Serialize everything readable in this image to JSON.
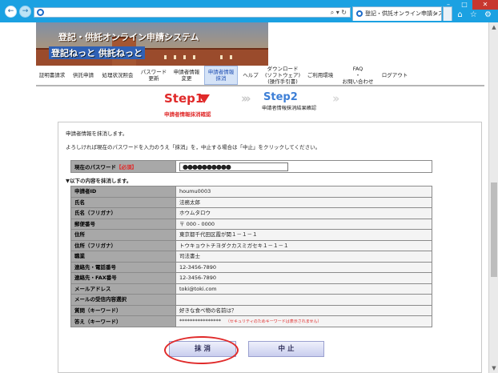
{
  "browser": {
    "tab_title": "登記・供託オンライン申請シス...",
    "address_controls": "⌕ ▾ ↻",
    "back_icon": "←",
    "forward_icon": "→",
    "window_buttons": [
      "–",
      "□",
      "✕"
    ],
    "toolbar_icons": "⌂ ☆ ⚙"
  },
  "banner": {
    "title": "登記・供託オンライン申請システム",
    "subtitle": "登記ねっと 供託ねっと"
  },
  "nav": [
    {
      "label": "証明書請求"
    },
    {
      "label": "供託申請"
    },
    {
      "label": "処理状況照会"
    },
    {
      "label": "パスワード\n更新"
    },
    {
      "label": "申請者情報\n変更"
    },
    {
      "label": "申請者情報\n抹消",
      "active": true
    },
    {
      "label": "ヘルプ"
    },
    {
      "label": "ダウンロード\n(ソフトウェア)\n(操作手引書)"
    },
    {
      "label": "ご利用環境"
    },
    {
      "label": "FAQ\n・\nお問い合わせ"
    },
    {
      "label": "ログアウト"
    }
  ],
  "steps": {
    "step1_label": "Step1",
    "step1_sub": "申請者情報抹消確認",
    "step2_label": "Step2",
    "step2_sub": "申請者情報抹消結果確認"
  },
  "messages": {
    "line1": "申請者情報を抹消します。",
    "line2": "よろしければ現在のパスワードを入力のうえ「抹消」を，中止する場合は「中止」をクリックしてください。",
    "note": "▼以下の内容を抹消します。"
  },
  "password": {
    "label": "現在のパスワード",
    "required": "【必須】",
    "value": "●●●●●●●●●●"
  },
  "details": [
    {
      "label": "申請者ID",
      "value": "houmu0003"
    },
    {
      "label": "氏名",
      "value": "法務太郎"
    },
    {
      "label": "氏名（フリガナ）",
      "value": "ホウムタロウ"
    },
    {
      "label": "郵便番号",
      "value": "〒 000 - 0000"
    },
    {
      "label": "住所",
      "value": "東京都千代田区霞が関１－１－１"
    },
    {
      "label": "住所（フリガナ）",
      "value": "トウキョウトチヨダクカスミガセキ１－１－１"
    },
    {
      "label": "職業",
      "value": "司法書士"
    },
    {
      "label": "連絡先・電話番号",
      "value": "12-3456-7890"
    },
    {
      "label": "連絡先・FAX番号",
      "value": "12-3456-7890"
    },
    {
      "label": "メールアドレス",
      "value": "toki@toki.com"
    },
    {
      "label": "メールの受信内容選択",
      "value": ""
    },
    {
      "label": "質問（キーワード）",
      "value": "好きな食べ物の名前は？"
    },
    {
      "label": "答え（キーワード）",
      "value": "****************",
      "note": "（セキュリティのためキーワードは表示されません）"
    }
  ],
  "buttons": {
    "delete": "抹 消",
    "cancel": "中 止"
  },
  "colors": {
    "accent_red": "#e02a2a",
    "step2_blue": "#3d7fd6",
    "titlebar": "#1ba1e2"
  }
}
